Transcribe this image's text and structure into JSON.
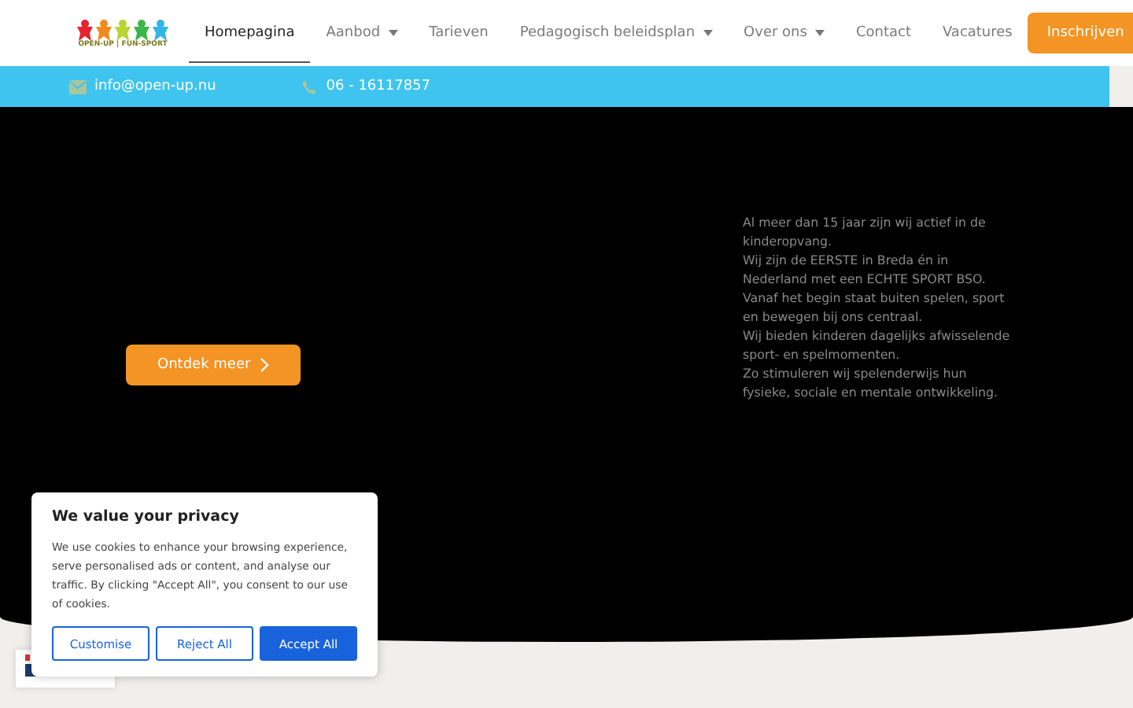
{
  "header": {
    "logo_text": "OPEN-UP | FUN-SPORT",
    "nav": [
      {
        "label": "Homepagina",
        "selected": true,
        "dropdown": false
      },
      {
        "label": "Aanbod",
        "selected": false,
        "dropdown": true
      },
      {
        "label": "Tarieven",
        "selected": false,
        "dropdown": false
      },
      {
        "label": "Pedagogisch beleidsplan",
        "selected": false,
        "dropdown": true
      },
      {
        "label": "Over ons",
        "selected": false,
        "dropdown": true
      },
      {
        "label": "Contact",
        "selected": false,
        "dropdown": false
      },
      {
        "label": "Vacatures",
        "selected": false,
        "dropdown": false
      }
    ],
    "cta": "Inschrijven"
  },
  "contact_bar": {
    "email": "info@open-up.nu",
    "phone": "06 - 16117857"
  },
  "hero": {
    "button": "Ontdek meer",
    "paragraphs": [
      "Al meer dan 15 jaar zijn wij actief in de kinderopvang.",
      "Wij zijn de EERSTE in Breda én in Nederland met een ECHTE SPORT BSO.",
      "Vanaf het begin staat buiten spelen, sport en bewegen bij ons centraal.",
      "Wij bieden kinderen dagelijks afwisselende sport- en spelmomenten.",
      "Zo stimuleren wij spelenderwijs hun fysieke, sociale en mentale ontwikkeling."
    ]
  },
  "cookie_banner": {
    "title": "We value your privacy",
    "text": "We use cookies to enhance your browsing experience, serve personalised ads or content, and analyse our traffic. By clicking \"Accept All\", you consent to our use of cookies.",
    "buttons": [
      {
        "label": "Customise",
        "kind": "outline"
      },
      {
        "label": "Reject All",
        "kind": "outline"
      },
      {
        "label": "Accept All",
        "kind": "primary"
      }
    ]
  }
}
